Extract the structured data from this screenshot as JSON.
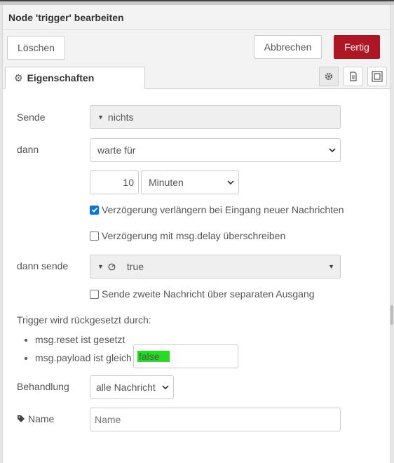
{
  "dialog": {
    "title": "Node 'trigger' bearbeiten",
    "buttons": {
      "delete": "Löschen",
      "cancel": "Abbrechen",
      "done": "Fertig"
    },
    "tab": {
      "label": "Eigenschaften",
      "icon": "gear-icon"
    },
    "tab_icons": [
      "gear-icon",
      "document-icon",
      "frame-icon"
    ]
  },
  "form": {
    "send": {
      "label": "Sende",
      "value": "nichts"
    },
    "then": {
      "label": "dann",
      "value": "warte für"
    },
    "delay": {
      "amount": "10",
      "unit": "Minuten"
    },
    "extend_delay": {
      "label": "Verzögerung verlängern bei Eingang neuer Nachrichten",
      "checked": true
    },
    "override_delay": {
      "label": "Verzögerung mit msg.delay überschreiben",
      "checked": false
    },
    "then_send": {
      "label": "dann sende",
      "type_icon": "clock-icon",
      "value": "true"
    },
    "second_output": {
      "label": "Sende zweite Nachricht über separaten Ausgang",
      "checked": false
    },
    "reset": {
      "heading": "Trigger wird rückgesetzt durch:",
      "item1": "msg.reset ist gesetzt",
      "item2": "msg.payload ist gleich",
      "payload_value": "false"
    },
    "handling": {
      "label": "Behandlung",
      "value": "alle Nachricht"
    },
    "name": {
      "label": "Name",
      "placeholder": "Name",
      "value": ""
    }
  },
  "colors": {
    "accent": "#ad1625",
    "checkbox": "#0b74de",
    "highlight": "#22dd22"
  }
}
